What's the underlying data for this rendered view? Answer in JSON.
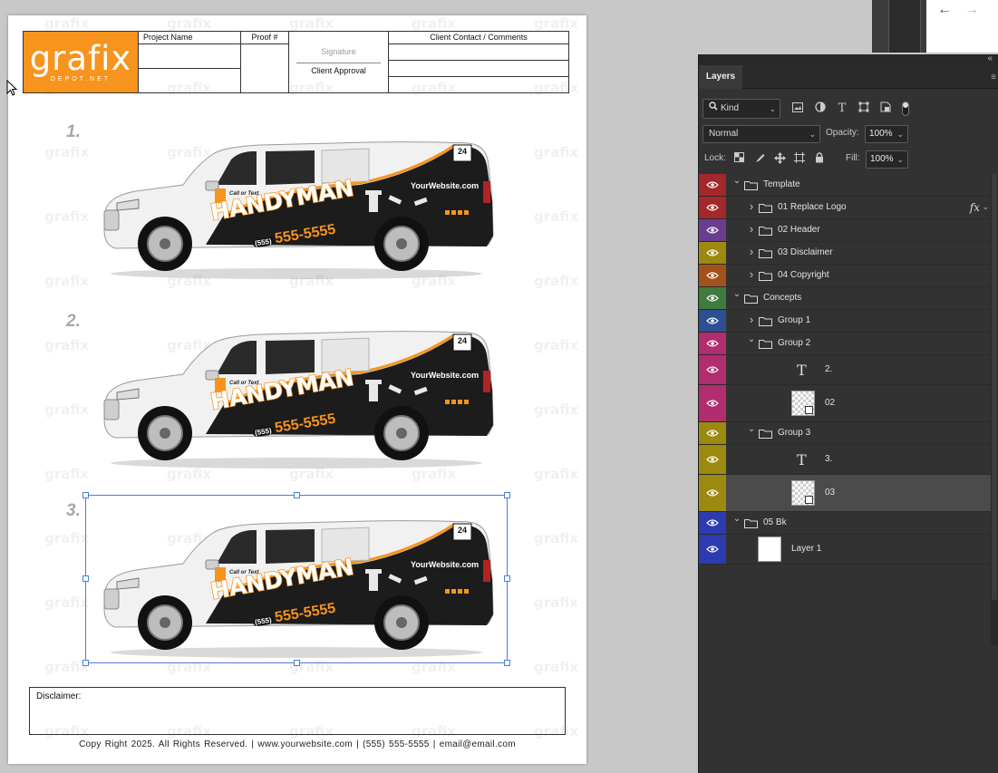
{
  "document": {
    "watermark": "grafix",
    "logo": {
      "word": "grafix",
      "sub": "DEPOT.NET"
    },
    "header": {
      "project_name": "Project Name",
      "proof": "Proof #",
      "signature": "Signature",
      "client_approval": "Client Approval",
      "client_contact": "Client Contact / Comments"
    },
    "concepts": [
      {
        "number": "1."
      },
      {
        "number": "2."
      },
      {
        "number": "3."
      }
    ],
    "truck_wrap": {
      "headline": "HANDYMAN",
      "phone_prefix": "(555)",
      "phone": "555-5555",
      "website": "YourWebsite.com",
      "call_text": "Call or Text",
      "badge": "24",
      "colors": {
        "body": "#f1f1f1",
        "wrap": "#1c1c1c",
        "accent": "#f7941d"
      }
    },
    "disclaimer_label": "Disclaimer:",
    "footer": "Copy Right 2025. All Rights Reserved.   |   www.yourwebsite.com   |   (555) 555-5555   |   email@email.com"
  },
  "browser": {
    "back_icon": "←",
    "forward_icon": "→"
  },
  "layers_panel": {
    "collapse_icon": "«",
    "tab": "Layers",
    "menu_icon": "≡",
    "filter": {
      "kind": "Kind"
    },
    "blend_mode": "Normal",
    "opacity_label": "Opacity:",
    "opacity": "100%",
    "lock_label": "Lock:",
    "fill_label": "Fill:",
    "fill": "100%",
    "layers": [
      {
        "name": "Template",
        "type": "group",
        "indent": 0,
        "expanded": true,
        "color": "#a2282c"
      },
      {
        "name": "01 Replace Logo",
        "type": "group",
        "indent": 1,
        "expanded": false,
        "color": "#a2282c",
        "fx": true
      },
      {
        "name": "02 Header",
        "type": "group",
        "indent": 1,
        "expanded": false,
        "color": "#6a3d8f"
      },
      {
        "name": "03 Disclaimer",
        "type": "group",
        "indent": 1,
        "expanded": false,
        "color": "#9c8a10"
      },
      {
        "name": "04 Copyright",
        "type": "group",
        "indent": 1,
        "expanded": false,
        "color": "#a0521a"
      },
      {
        "name": "Concepts",
        "type": "group",
        "indent": 0,
        "expanded": true,
        "color": "#3f7a3f"
      },
      {
        "name": "Group 1",
        "type": "group",
        "indent": 1,
        "expanded": false,
        "color": "#2e4f92"
      },
      {
        "name": "Group 2",
        "type": "group",
        "indent": 1,
        "expanded": true,
        "color": "#b02e6e"
      },
      {
        "name": "2.",
        "type": "text",
        "indent": 2,
        "color": "#b02e6e"
      },
      {
        "name": "02",
        "type": "smart",
        "indent": 2,
        "color": "#b02e6e"
      },
      {
        "name": "Group 3",
        "type": "group",
        "indent": 1,
        "expanded": true,
        "color": "#9c8a10"
      },
      {
        "name": "3.",
        "type": "text",
        "indent": 2,
        "color": "#9c8a10"
      },
      {
        "name": "03",
        "type": "smart",
        "indent": 2,
        "color": "#9c8a10",
        "selected": true
      },
      {
        "name": "05 Bk",
        "type": "group",
        "indent": 0,
        "expanded": true,
        "color": "#2d3bb0"
      },
      {
        "name": "Layer 1",
        "type": "pixel",
        "indent": 1,
        "color": "#2d3bb0"
      }
    ]
  }
}
